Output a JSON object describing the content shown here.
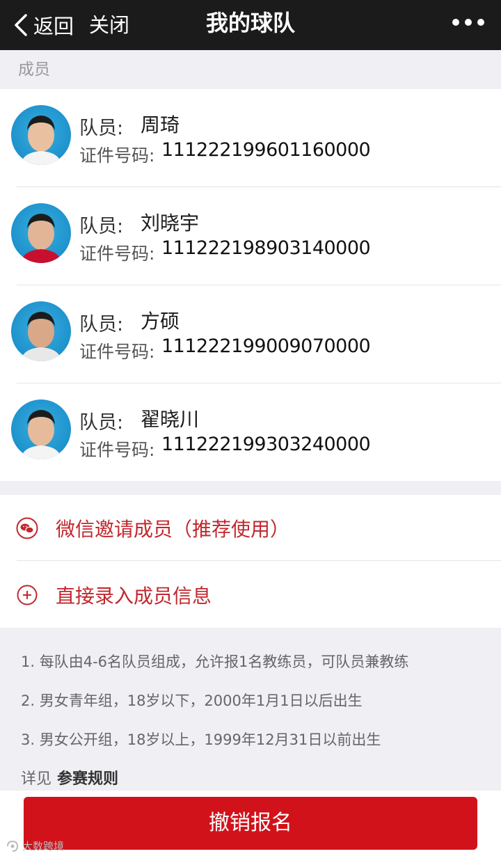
{
  "header": {
    "back_label": "返回",
    "close_label": "关闭",
    "title": "我的球队"
  },
  "members_section": {
    "label": "成员",
    "name_label": "队员:",
    "id_label": "证件号码:",
    "members": [
      {
        "name": "周琦",
        "id": "111222199601160000"
      },
      {
        "name": "刘晓宇",
        "id": "111222198903140000"
      },
      {
        "name": "方硕",
        "id": "111222199009070000"
      },
      {
        "name": "翟晓川",
        "id": "111222199303240000"
      }
    ]
  },
  "actions": {
    "wechat_invite": "微信邀请成员（推荐使用）",
    "direct_entry": "直接录入成员信息"
  },
  "notes": [
    "1. 每队由4-6名队员组成，允许报1名教练员，可队员兼教练",
    "2. 男女青年组，18岁以下，2000年1月1日以后出生",
    "3. 男女公开组，18岁以上，1999年12月31日以前出生"
  ],
  "rules": {
    "prefix": "详见",
    "link": "参赛规则"
  },
  "cancel_button": "撤销报名",
  "watermark": "大数跨境",
  "colors": {
    "accent": "#c1272d",
    "button": "#d1121b",
    "header_bg": "#1b1b1b",
    "page_bg": "#efeff4"
  }
}
